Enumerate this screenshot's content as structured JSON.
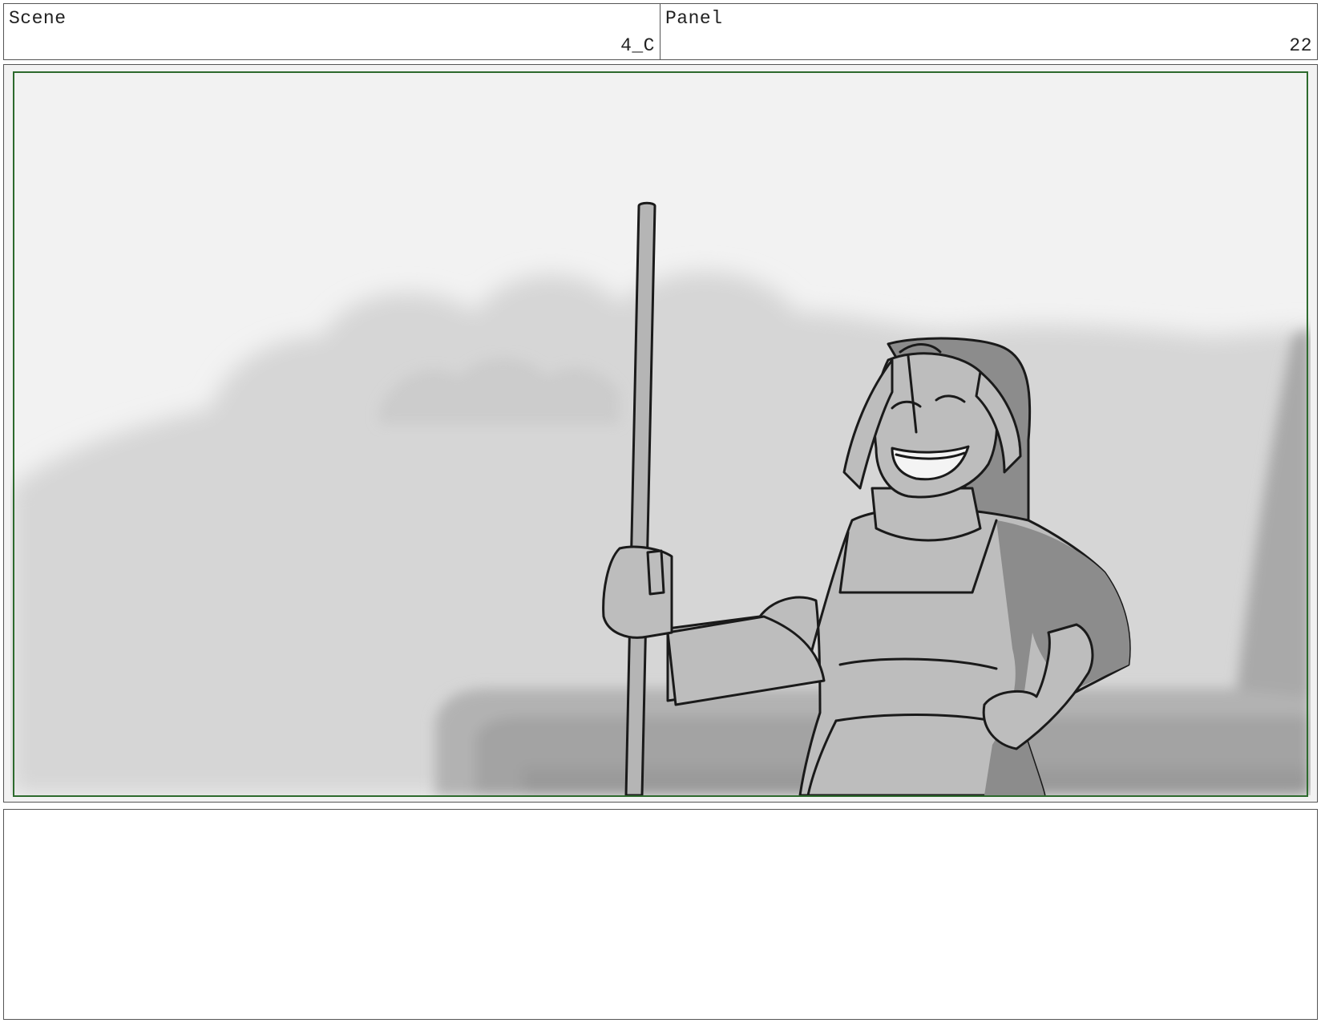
{
  "header": {
    "scene_label": "Scene",
    "scene_value": "4_C",
    "panel_label": "Panel",
    "panel_value": "22"
  },
  "colors": {
    "frame_border": "#555555",
    "safe_frame": "#2d6a2d",
    "sky": "#f2f2f2",
    "clouds": "#d2d2d2",
    "figure_fill": "#bdbdbd",
    "shadow": "#8c8c8c",
    "ink": "#1a1a1a"
  },
  "notes": {
    "text": ""
  }
}
